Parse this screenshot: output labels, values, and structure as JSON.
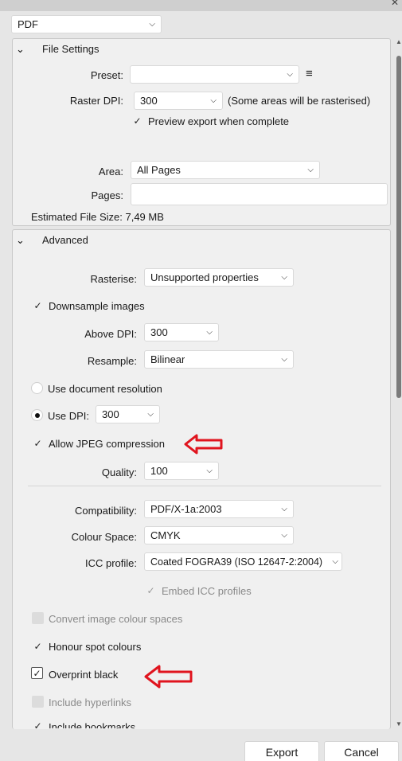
{
  "format": {
    "value": "PDF"
  },
  "file_settings": {
    "title": "File Settings",
    "preset_label": "Preset:",
    "preset_value": "",
    "raster_dpi_label": "Raster DPI:",
    "raster_dpi_value": "300",
    "raster_note": "(Some areas will be rasterised)",
    "preview_label": "Preview export when complete",
    "area_label": "Area:",
    "area_value": "All Pages",
    "pages_label": "Pages:",
    "pages_value": "",
    "estimated_size": "Estimated File Size: 7,49 MB"
  },
  "advanced": {
    "title": "Advanced",
    "rasterise_label": "Rasterise:",
    "rasterise_value": "Unsupported properties",
    "downsample_label": "Downsample images",
    "above_dpi_label": "Above DPI:",
    "above_dpi_value": "300",
    "resample_label": "Resample:",
    "resample_value": "Bilinear",
    "use_doc_res_label": "Use document resolution",
    "use_dpi_label": "Use DPI:",
    "use_dpi_value": "300",
    "jpeg_label": "Allow JPEG compression",
    "quality_label": "Quality:",
    "quality_value": "100",
    "compat_label": "Compatibility:",
    "compat_value": "PDF/X-1a:2003",
    "colour_space_label": "Colour Space:",
    "colour_space_value": "CMYK",
    "icc_label": "ICC profile:",
    "icc_value": "Coated FOGRA39 (ISO 12647-2:2004)",
    "embed_icc_label": "Embed ICC profiles",
    "convert_label": "Convert image colour spaces",
    "honour_spot_label": "Honour spot colours",
    "overprint_label": "Overprint black",
    "hyperlinks_label": "Include hyperlinks",
    "bookmarks_label": "Include bookmarks"
  },
  "buttons": {
    "export": "Export",
    "cancel": "Cancel"
  },
  "colors": {
    "annotation_arrow": "#e0141e",
    "panel_bg": "#f0f0f0",
    "window_bg": "#e6e6e6"
  }
}
